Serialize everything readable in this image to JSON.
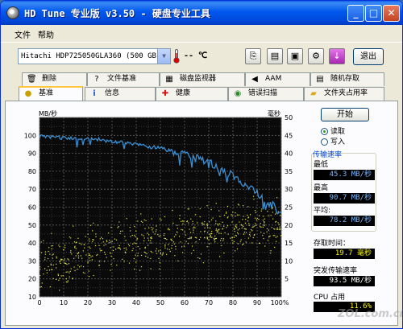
{
  "window": {
    "title": "HD Tune 专业版 v3.50 - 硬盘专业工具"
  },
  "menu": {
    "file": "文件",
    "help": "帮助"
  },
  "toolbar": {
    "drive": "Hitachi HDP725050GLA360 (500 GB)",
    "temperature": "-- ℃",
    "exit_label": "退出"
  },
  "tabs_top": [
    {
      "label": "删除",
      "icon": "trash-icon"
    },
    {
      "label": "文件基准",
      "icon": "file-benchmark-icon"
    },
    {
      "label": "磁盘监视器",
      "icon": "disk-monitor-icon"
    },
    {
      "label": "AAM",
      "icon": "speaker-icon"
    },
    {
      "label": "随机存取",
      "icon": "random-access-icon"
    }
  ],
  "tabs_bottom": [
    {
      "label": "基准",
      "icon": "benchmark-icon",
      "active": true
    },
    {
      "label": "信息",
      "icon": "info-icon"
    },
    {
      "label": "健康",
      "icon": "health-cross-icon"
    },
    {
      "label": "错误扫描",
      "icon": "error-scan-icon"
    },
    {
      "label": "文件夹占用率",
      "icon": "folder-usage-icon"
    }
  ],
  "panel": {
    "start_label": "开始",
    "read_label": "读取",
    "write_label": "写入",
    "group_title": "传输速率",
    "min_label": "最低",
    "min_value": "45.3",
    "min_unit": "MB/秒",
    "max_label": "最高",
    "max_value": "90.7",
    "max_unit": "MB/秒",
    "avg_label": "平均:",
    "avg_value": "78.2",
    "avg_unit": "MB/秒",
    "access_label": "存取时间：",
    "access_value": "19.7",
    "access_unit": "毫秒",
    "burst_label": "突发传输速率",
    "burst_value": "93.5",
    "burst_unit": "MB/秒",
    "cpu_label": "CPU 占用",
    "cpu_value": "11.6%"
  },
  "watermark": "ZOL.com.cn",
  "colors": {
    "transfer_line": "#3a8fd4",
    "access_points": "#e6e64a",
    "chart_bg": "#0a0a0a",
    "grid": "#606060"
  },
  "chart_data": {
    "type": "line",
    "y_left_label": "MB/秒",
    "y_right_label": "毫秒",
    "y_left_ticks": [
      "100",
      "90",
      "80",
      "70",
      "60",
      "50",
      "40",
      "30",
      "20",
      "10"
    ],
    "y_right_ticks": [
      "50",
      "45",
      "40",
      "35",
      "30",
      "25",
      "20",
      "15",
      "10",
      "5"
    ],
    "x_ticks": [
      "0",
      "10",
      "20",
      "30",
      "40",
      "50",
      "60",
      "70",
      "80",
      "90",
      "100%"
    ],
    "ylim_left": [
      0,
      100
    ],
    "ylim_right": [
      0,
      50
    ],
    "xlim": [
      0,
      100
    ],
    "grid": true,
    "series": [
      {
        "type": "line",
        "axis": "left",
        "x": [
          0,
          5,
          10,
          15,
          20,
          25,
          30,
          35,
          40,
          45,
          50,
          55,
          60,
          65,
          70,
          75,
          80,
          85,
          90,
          95,
          100
        ],
        "values": [
          89.5,
          89.0,
          88.6,
          88.2,
          88.0,
          87.6,
          86.8,
          86.0,
          85.0,
          83.8,
          82.8,
          80.8,
          79.0,
          77.2,
          74.5,
          71.5,
          67.8,
          62.5,
          58.0,
          52.5,
          47.0
        ]
      },
      {
        "type": "scatter",
        "axis": "right",
        "x_range": [
          0,
          100
        ],
        "trend": [
          [
            0,
            9
          ],
          [
            20,
            12.5
          ],
          [
            40,
            15
          ],
          [
            60,
            17
          ],
          [
            80,
            19
          ],
          [
            100,
            20.5
          ]
        ],
        "spread": 6.5,
        "count": 620
      }
    ]
  }
}
